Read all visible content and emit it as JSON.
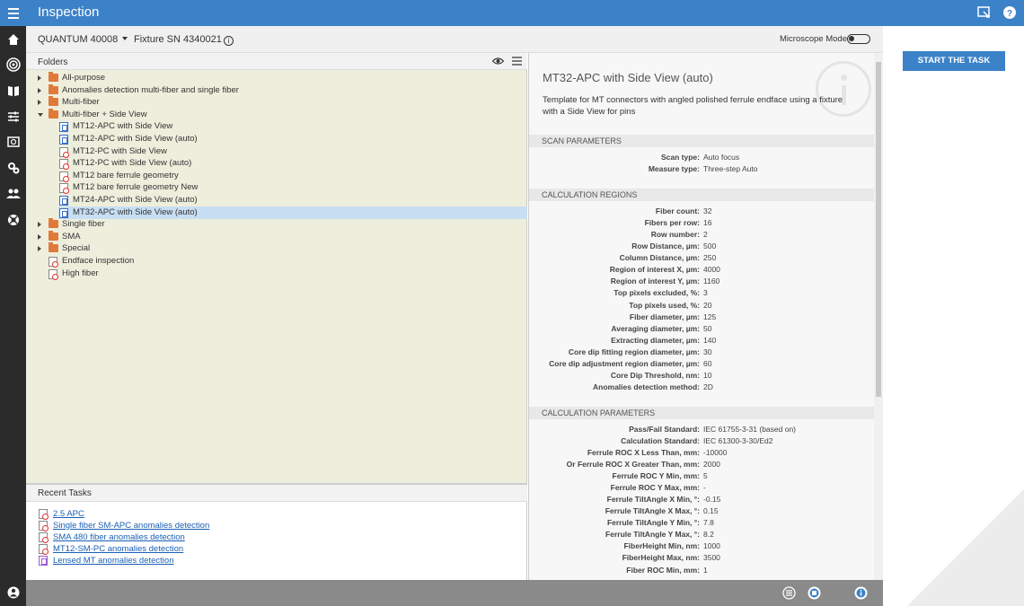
{
  "app": {
    "title": "Inspection"
  },
  "header": {
    "model": "QUANTUM 40008",
    "fixture_label": "Fixture SN",
    "fixture_value": "4340021",
    "microscope_mode_label": "Microscope Mode",
    "microscope_mode_on": false
  },
  "folders_panel": {
    "title": "Folders",
    "tree": [
      {
        "label": "All-purpose",
        "type": "folder",
        "level": 0,
        "expanded": false
      },
      {
        "label": "Anomalies detection multi-fiber and single fiber",
        "type": "folder",
        "level": 0,
        "expanded": false
      },
      {
        "label": "Multi-fiber",
        "type": "folder",
        "level": 0,
        "expanded": false
      },
      {
        "label": "Multi-fiber + Side View",
        "type": "folder",
        "level": 0,
        "expanded": true
      },
      {
        "label": "MT12-APC with Side View",
        "type": "blue",
        "level": 1
      },
      {
        "label": "MT12-APC with Side View (auto)",
        "type": "blue",
        "level": 1
      },
      {
        "label": "MT12-PC with Side View",
        "type": "red",
        "level": 1
      },
      {
        "label": "MT12-PC with Side View (auto)",
        "type": "red",
        "level": 1
      },
      {
        "label": "MT12 bare ferrule geometry",
        "type": "red",
        "level": 1
      },
      {
        "label": "MT12 bare ferrule geometry New",
        "type": "red",
        "level": 1
      },
      {
        "label": "MT24-APC with Side View (auto)",
        "type": "blue",
        "level": 1
      },
      {
        "label": "MT32-APC with Side View (auto)",
        "type": "blue",
        "level": 1,
        "selected": true
      },
      {
        "label": "Single fiber",
        "type": "folder",
        "level": 0,
        "expanded": false
      },
      {
        "label": "SMA",
        "type": "folder",
        "level": 0,
        "expanded": false
      },
      {
        "label": "Special",
        "type": "folder",
        "level": 0,
        "expanded": false
      },
      {
        "label": "Endface inspection",
        "type": "red",
        "level": 0
      },
      {
        "label": "High fiber",
        "type": "red",
        "level": 0
      }
    ]
  },
  "recent_tasks": {
    "title": "Recent Tasks",
    "items": [
      {
        "label": "2.5 APC",
        "icon": "red"
      },
      {
        "label": "Single fiber SM-APC anomalies detection",
        "icon": "red"
      },
      {
        "label": "SMA 480 fiber anomalies detection",
        "icon": "red"
      },
      {
        "label": "MT12-SM-PC anomalies detection",
        "icon": "red"
      },
      {
        "label": "Lensed MT anomalies detection",
        "icon": "purple"
      }
    ]
  },
  "detail": {
    "title": "MT32-APC with Side View (auto)",
    "description": "Template for MT connectors with angled polished ferrule endface using a fixture with a Side View for pins",
    "sections": [
      {
        "title": "SCAN PARAMETERS",
        "rows": [
          {
            "k": "Scan type:",
            "v": "Auto focus"
          },
          {
            "k": "Measure type:",
            "v": "Three-step Auto"
          }
        ]
      },
      {
        "title": "CALCULATION REGIONS",
        "rows": [
          {
            "k": "Fiber count:",
            "v": "32"
          },
          {
            "k": "Fibers per row:",
            "v": "16"
          },
          {
            "k": "Row number:",
            "v": "2"
          },
          {
            "k": "Row Distance, µm:",
            "v": "500"
          },
          {
            "k": "Column Distance, µm:",
            "v": "250"
          },
          {
            "k": "Region of interest X, µm:",
            "v": "4000"
          },
          {
            "k": "Region of interest Y, µm:",
            "v": "1160"
          },
          {
            "k": "Top pixels excluded, %:",
            "v": "3"
          },
          {
            "k": "Top pixels used, %:",
            "v": "20"
          },
          {
            "k": "Fiber diameter, µm:",
            "v": "125"
          },
          {
            "k": "Averaging diameter, µm:",
            "v": "50"
          },
          {
            "k": "Extracting diameter, µm:",
            "v": "140"
          },
          {
            "k": "Core dip fitting region diameter, µm:",
            "v": "30"
          },
          {
            "k": "Core dip adjustment region diameter, µm:",
            "v": "60"
          },
          {
            "k": "Core Dip Threshold, nm:",
            "v": "10"
          },
          {
            "k": "Anomalies detection method:",
            "v": "2D"
          }
        ]
      },
      {
        "title": "CALCULATION PARAMETERS",
        "rows": [
          {
            "k": "Pass/Fail Standard:",
            "v": "IEC 61755-3-31 (based on)"
          },
          {
            "k": "Calculation Standard:",
            "v": "IEC 61300-3-30/Ed2"
          },
          {
            "k": "Ferrule ROC X Less Than, mm:",
            "v": "-10000"
          },
          {
            "k": "Or Ferrule ROC X Greater Than, mm:",
            "v": "2000"
          },
          {
            "k": "Ferrule ROC Y Min, mm:",
            "v": "5"
          },
          {
            "k": "Ferrule ROC Y Max, mm:",
            "v": "-"
          },
          {
            "k": "Ferrule TiltAngle X Min, °:",
            "v": "-0.15"
          },
          {
            "k": "Ferrule TiltAngle X Max, °:",
            "v": "0.15"
          },
          {
            "k": "Ferrule TiltAngle Y Min, °:",
            "v": "7.8"
          },
          {
            "k": "Ferrule TiltAngle Y Max, °:",
            "v": "8.2"
          },
          {
            "k": "FiberHeight Min, nm:",
            "v": "1000"
          },
          {
            "k": "FiberHeight Max, nm:",
            "v": "3500"
          },
          {
            "k": "Fiber ROC Min, mm:",
            "v": "1"
          }
        ]
      }
    ]
  },
  "actions": {
    "start_task": "START THE TASK"
  },
  "colors": {
    "accent": "#3c82c8",
    "nav_bg": "#2b2b2b",
    "tree_bg": "#eeeedd",
    "selected": "#c7def3"
  }
}
